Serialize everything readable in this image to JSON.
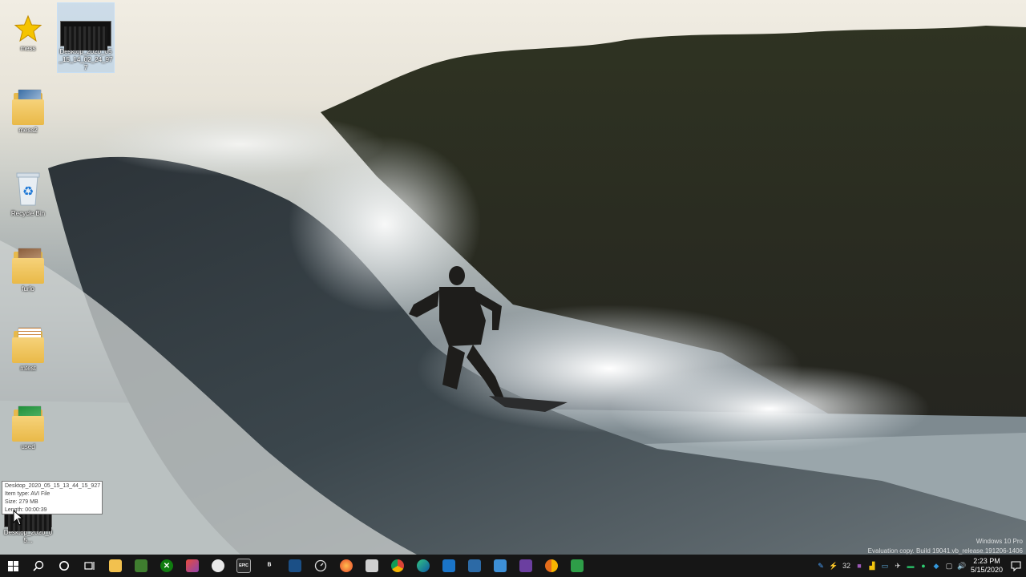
{
  "desktop_icons": [
    {
      "label": "mess"
    },
    {
      "label": "Desktop_2020_05_15_14_02_24_977"
    },
    {
      "label": "mess2"
    },
    {
      "label": "Recycle Bin"
    },
    {
      "label": "furlo"
    },
    {
      "label": "mtest"
    },
    {
      "label": "used"
    },
    {
      "label": "Desktop_2020_05..."
    }
  ],
  "tooltip": {
    "name": "Desktop_2020_05_15_13_44_15_927",
    "type": "Item type: AVI File",
    "size": "Size: 279 MB",
    "length": "Length: 00:00:39"
  },
  "watermark": {
    "line1": "Windows 10 Pro",
    "line2": "Evaluation copy. Build 19041.vb_release.191206-1406"
  },
  "taskbar": {
    "apps": [
      "file-explorer",
      "xbox-app",
      "photos",
      "paint",
      "epic-games",
      "bold-app",
      "steam",
      "speedtest",
      "firefox-nightly",
      "store",
      "chrome",
      "edge",
      "calculator",
      "shop",
      "onscreen",
      "obs",
      "chrome-canary",
      "excel-like"
    ],
    "tray_number": "32",
    "clock_time": "2:23 PM",
    "clock_date": "5/15/2020"
  },
  "colors": {
    "taskbar_bg": "#161616",
    "folder": "#e9b948",
    "accent": "#0078d7"
  }
}
